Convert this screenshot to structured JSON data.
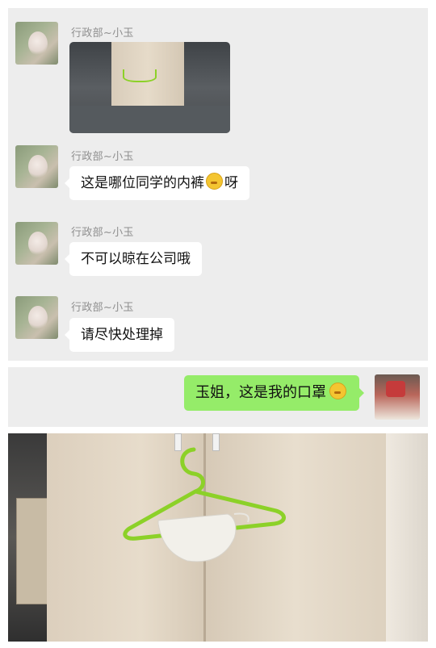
{
  "chat": {
    "messages": [
      {
        "sender": "行政部~小玉",
        "type": "image"
      },
      {
        "sender": "行政部~小玉",
        "text": "这是哪位同学的内裤",
        "suffix": "呀"
      },
      {
        "sender": "行政部~小玉",
        "text": "不可以晾在公司哦"
      },
      {
        "sender": "行政部~小玉",
        "text": "请尽快处理掉"
      }
    ],
    "reply": {
      "text": "玉姐，这是我的口罩"
    }
  },
  "colors": {
    "chat_bg": "#ededed",
    "incoming_bubble": "#ffffff",
    "outgoing_bubble": "#95ec69",
    "sender_name": "#8f8f8f",
    "hanger": "#8cd128"
  },
  "icons": {
    "emoji_1": "flustered-face-emoji",
    "emoji_2": "smiling-face-emoji"
  }
}
